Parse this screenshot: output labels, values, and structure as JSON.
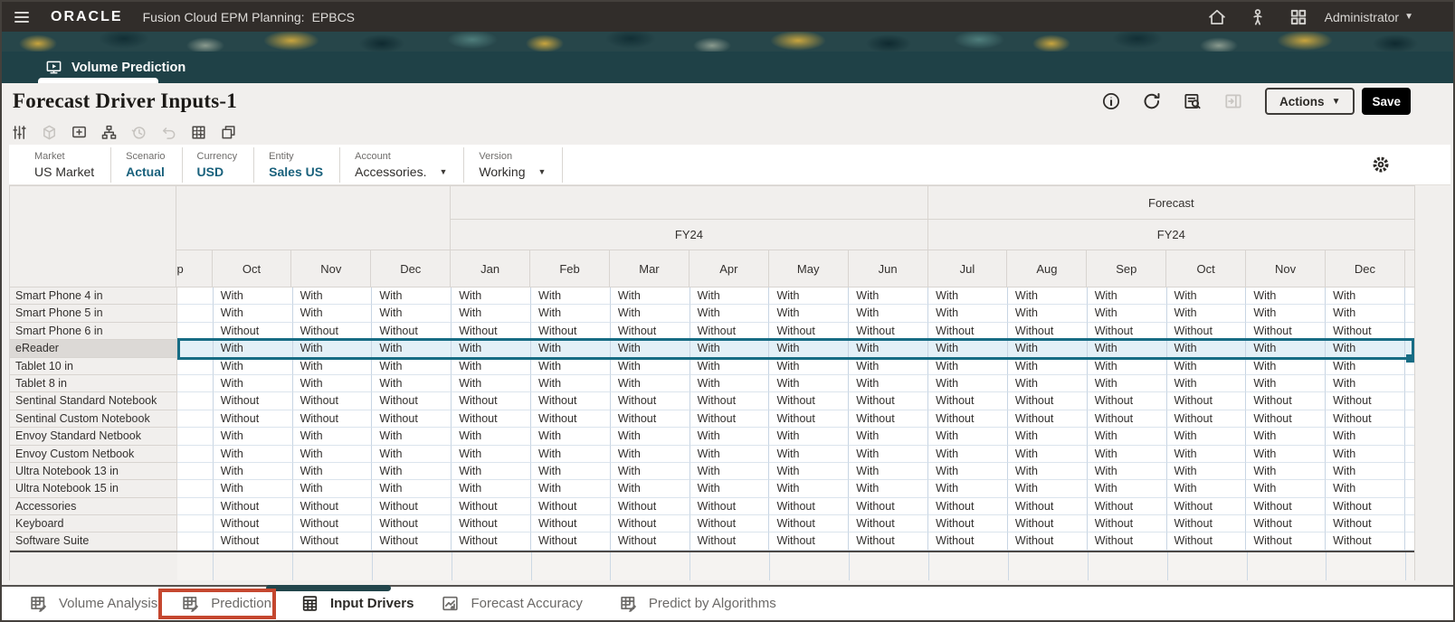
{
  "topbar": {
    "brand": "ORACLE",
    "product": "Fusion Cloud EPM Planning:",
    "app": "EPBCS",
    "user": "Administrator",
    "icons": [
      "menu-icon",
      "home-icon",
      "person-icon",
      "apps-icon",
      "caret-down-icon"
    ]
  },
  "nav": {
    "tab_label": "Volume Prediction",
    "tab_icon": "monitor-play-icon"
  },
  "page": {
    "title": "Forecast Driver Inputs-1",
    "header_icons": [
      {
        "name": "info-icon",
        "enabled": true
      },
      {
        "name": "refresh-icon",
        "enabled": true
      },
      {
        "name": "job-console-icon",
        "enabled": true
      },
      {
        "name": "open-panel-icon",
        "enabled": false
      }
    ],
    "actions_label": "Actions",
    "save_label": "Save"
  },
  "toolbar": {
    "icons": [
      {
        "name": "adjust-sliders-icon",
        "enabled": true
      },
      {
        "name": "cube-icon",
        "enabled": false
      },
      {
        "name": "comment-icon",
        "enabled": true
      },
      {
        "name": "hierarchy-icon",
        "enabled": true
      },
      {
        "name": "history-icon",
        "enabled": false
      },
      {
        "name": "undo-icon",
        "enabled": false
      },
      {
        "name": "grid-cells-icon",
        "enabled": true
      },
      {
        "name": "new-window-icon",
        "enabled": true
      }
    ]
  },
  "pov": {
    "settings_icon": "gear-icon",
    "segments": [
      {
        "label": "Market",
        "value": "US Market",
        "link": false,
        "dropdown": false
      },
      {
        "label": "Scenario",
        "value": "Actual",
        "link": true,
        "dropdown": false
      },
      {
        "label": "Currency",
        "value": "USD",
        "link": true,
        "dropdown": false
      },
      {
        "label": "Entity",
        "value": "Sales US",
        "link": true,
        "dropdown": false
      },
      {
        "label": "Account",
        "value": "Accessories.",
        "link": false,
        "dropdown": true
      },
      {
        "label": "Version",
        "value": "Working",
        "link": false,
        "dropdown": true
      }
    ]
  },
  "grid": {
    "scenario_header": "Forecast",
    "year_headers": [
      "",
      "FY24",
      "FY24"
    ],
    "partial_month_visible": "p",
    "months": [
      "Oct",
      "Nov",
      "Dec",
      "Jan",
      "Feb",
      "Mar",
      "Apr",
      "May",
      "Jun",
      "Jul",
      "Aug",
      "Sep",
      "Oct",
      "Nov",
      "Dec"
    ],
    "rows": [
      {
        "label": "Smart Phone 4 in",
        "value": "With",
        "selected": false
      },
      {
        "label": "Smart Phone 5 in",
        "value": "With",
        "selected": false
      },
      {
        "label": "Smart Phone 6 in",
        "value": "Without",
        "selected": false
      },
      {
        "label": "eReader",
        "value": "With",
        "selected": true
      },
      {
        "label": "Tablet 10 in",
        "value": "With",
        "selected": false
      },
      {
        "label": "Tablet 8 in",
        "value": "With",
        "selected": false
      },
      {
        "label": "Sentinal Standard Notebook",
        "value": "Without",
        "selected": false
      },
      {
        "label": "Sentinal Custom Notebook",
        "value": "Without",
        "selected": false
      },
      {
        "label": "Envoy Standard Netbook",
        "value": "With",
        "selected": false
      },
      {
        "label": "Envoy Custom Netbook",
        "value": "With",
        "selected": false
      },
      {
        "label": "Ultra Notebook 13 in",
        "value": "With",
        "selected": false
      },
      {
        "label": "Ultra Notebook 15 in",
        "value": "With",
        "selected": false
      },
      {
        "label": "Accessories",
        "value": "Without",
        "selected": false
      },
      {
        "label": "Keyboard",
        "value": "Without",
        "selected": false
      },
      {
        "label": "Software Suite",
        "value": "Without",
        "selected": false
      }
    ]
  },
  "bottom_tabs": {
    "tabs": [
      {
        "label": "Volume Analysis",
        "icon": "grid-pencil-icon",
        "active": false,
        "annotated": false
      },
      {
        "label": "Prediction",
        "icon": "grid-pencil-icon",
        "active": false,
        "annotated": true
      },
      {
        "label": "Input Drivers",
        "icon": "calculator-icon",
        "active": true,
        "annotated": false
      },
      {
        "label": "Forecast Accuracy",
        "icon": "chart-arrow-icon",
        "active": false,
        "annotated": false
      },
      {
        "label": "Predict by Algorithms",
        "icon": "grid-pencil-icon",
        "active": false,
        "annotated": false
      }
    ]
  },
  "colors": {
    "topbar_bg": "#312d2a",
    "teal_band": "#1f4147",
    "link_blue": "#19617c",
    "selection_teal": "#176c84",
    "save_button_bg": "#000000",
    "annotation_red": "#c5472f",
    "active_tab_indicator": "#22454b"
  }
}
